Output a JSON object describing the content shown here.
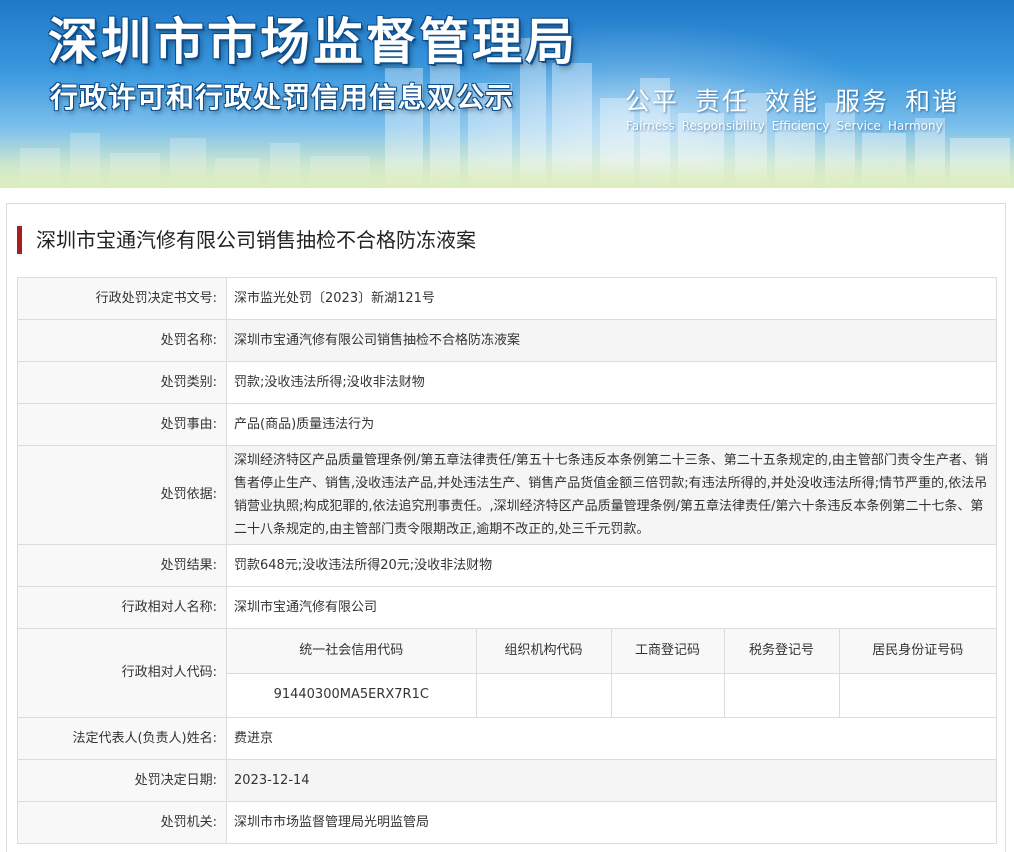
{
  "header": {
    "title": "深圳市市场监督管理局",
    "subtitle": "行政许可和行政处罚信用信息双公示",
    "slogan_cn": [
      "公平",
      "责任",
      "效能",
      "服务",
      "和谐"
    ],
    "slogan_en": [
      "Fairness",
      "Responsibility",
      "Efficiency",
      "Service",
      "Harmony"
    ]
  },
  "case": {
    "title": "深圳市宝通汽修有限公司销售抽检不合格防冻液案",
    "rows": [
      {
        "label": "行政处罚决定书文号:",
        "value": "深市监光处罚〔2023〕新湖121号"
      },
      {
        "label": "处罚名称:",
        "value": "深圳市宝通汽修有限公司销售抽检不合格防冻液案"
      },
      {
        "label": "处罚类别:",
        "value": "罚款;没收违法所得;没收非法财物"
      },
      {
        "label": "处罚事由:",
        "value": "产品(商品)质量违法行为"
      },
      {
        "label": "处罚依据:",
        "value": "深圳经济特区产品质量管理条例/第五章法律责任/第五十七条违反本条例第二十三条、第二十五条规定的,由主管部门责令生产者、销售者停止生产、销售,没收违法产品,并处违法生产、销售产品货值金额三倍罚款;有违法所得的,并处没收违法所得;情节严重的,依法吊销营业执照;构成犯罪的,依法追究刑事责任。,深圳经济特区产品质量管理条例/第五章法律责任/第六十条违反本条例第二十七条、第二十八条规定的,由主管部门责令限期改正,逾期不改正的,处三千元罚款。"
      },
      {
        "label": "处罚结果:",
        "value": "罚款648元;没收违法所得20元;没收非法财物"
      },
      {
        "label": "行政相对人名称:",
        "value": "深圳市宝通汽修有限公司"
      }
    ],
    "codes": {
      "label": "行政相对人代码:",
      "headers": [
        "统一社会信用代码",
        "组织机构代码",
        "工商登记码",
        "税务登记号",
        "居民身份证号码"
      ],
      "values": [
        "91440300MA5ERX7R1C",
        "",
        "",
        "",
        ""
      ]
    },
    "rows_after": [
      {
        "label": "法定代表人(负责人)姓名:",
        "value": "费进京"
      },
      {
        "label": "处罚决定日期:",
        "value": "2023-12-14"
      },
      {
        "label": "处罚机关:",
        "value": "深圳市市场监督管理局光明监管局"
      }
    ]
  }
}
